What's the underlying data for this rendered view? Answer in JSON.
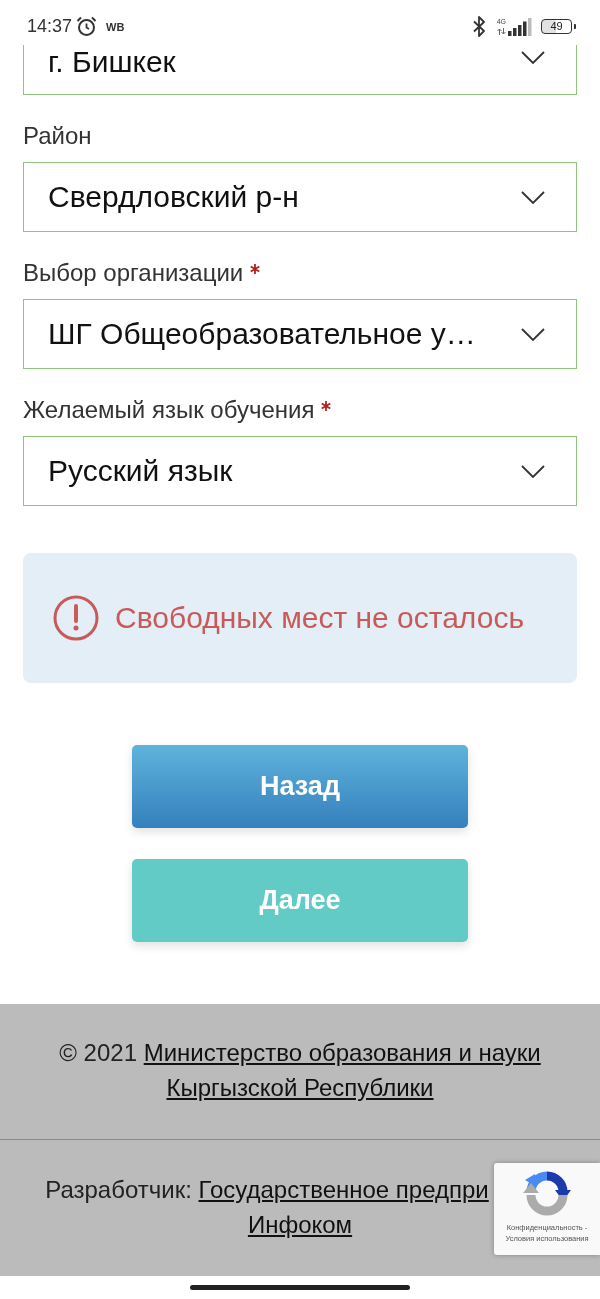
{
  "status_bar": {
    "time": "14:37",
    "notification": "WB",
    "network": "4G",
    "battery": "49"
  },
  "partial_field": {
    "value": "г. Бишкек"
  },
  "fields": [
    {
      "label": "Район",
      "required": false,
      "value": "Свердловский р-н"
    },
    {
      "label": "Выбор организации",
      "required": true,
      "value": "ШГ Общеобразовательное у…"
    },
    {
      "label": "Желаемый язык обучения",
      "required": true,
      "value": "Русский язык"
    }
  ],
  "alert": {
    "message": "Свободных мест не осталось"
  },
  "buttons": [
    {
      "label": "Назад",
      "kind": "secondary"
    },
    {
      "label": "Далее",
      "kind": "primary"
    }
  ],
  "footer": {
    "copyright": {
      "prefix": "© 2021",
      "links": [
        "Министерство образования и науки",
        "Кыргызской Республики"
      ]
    },
    "developer": {
      "prefix": "Разработчик:",
      "links": [
        "Государственное предпри",
        "Инфоком"
      ]
    }
  },
  "recaptcha": {
    "links": [
      "Конфиденциальность -",
      "Условия использования"
    ]
  }
}
